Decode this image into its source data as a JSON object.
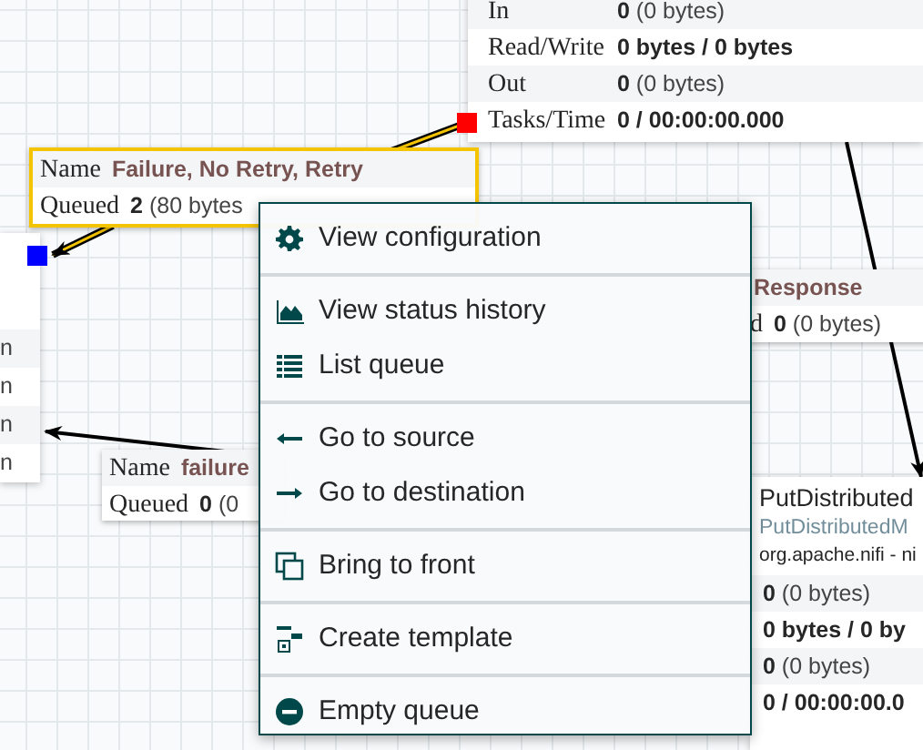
{
  "top_processor": {
    "stats": [
      {
        "label": "In",
        "bold": "0",
        "rest": "(0 bytes)"
      },
      {
        "label": "Read/Write",
        "bold": "0 bytes / 0 bytes"
      },
      {
        "label": "Out",
        "bold": "0",
        "rest": "(0 bytes)"
      },
      {
        "label": "Tasks/Time",
        "bold": "0 / 00:00:00.000"
      }
    ]
  },
  "left_processor": {
    "stats": [
      "n",
      "n",
      "n",
      "n"
    ]
  },
  "connections": [
    {
      "selected": true,
      "name_label": "Name",
      "name": "Failure, No Retry, Retry",
      "queued_label": "Queued",
      "count": "2",
      "size": "(80 bytes"
    },
    {
      "selected": false,
      "name_label": "Name",
      "name": "failure",
      "queued_label": "Queued",
      "count": "0",
      "size": "(0"
    },
    {
      "selected": false,
      "name": "Response",
      "queued_label": "d",
      "count": "0",
      "size": "(0 bytes)"
    }
  ],
  "bottom_processor": {
    "name": "PutDistributed",
    "type": "PutDistributedM",
    "bundle": "org.apache.nifi - ni",
    "stats": [
      {
        "bold": "0",
        "rest": "(0 bytes)"
      },
      {
        "bold": "0 bytes / 0 by"
      },
      {
        "bold": "0",
        "rest": "(0 bytes)"
      },
      {
        "bold": "0 / 00:00:00.0"
      }
    ]
  },
  "context_menu": {
    "groups": [
      [
        {
          "label": "View configuration"
        }
      ],
      [
        {
          "label": "View status history"
        },
        {
          "label": "List queue"
        }
      ],
      [
        {
          "label": "Go to source"
        },
        {
          "label": "Go to destination"
        }
      ],
      [
        {
          "label": "Bring to front"
        }
      ],
      [
        {
          "label": "Create template"
        }
      ],
      [
        {
          "label": "Empty queue"
        }
      ]
    ]
  }
}
